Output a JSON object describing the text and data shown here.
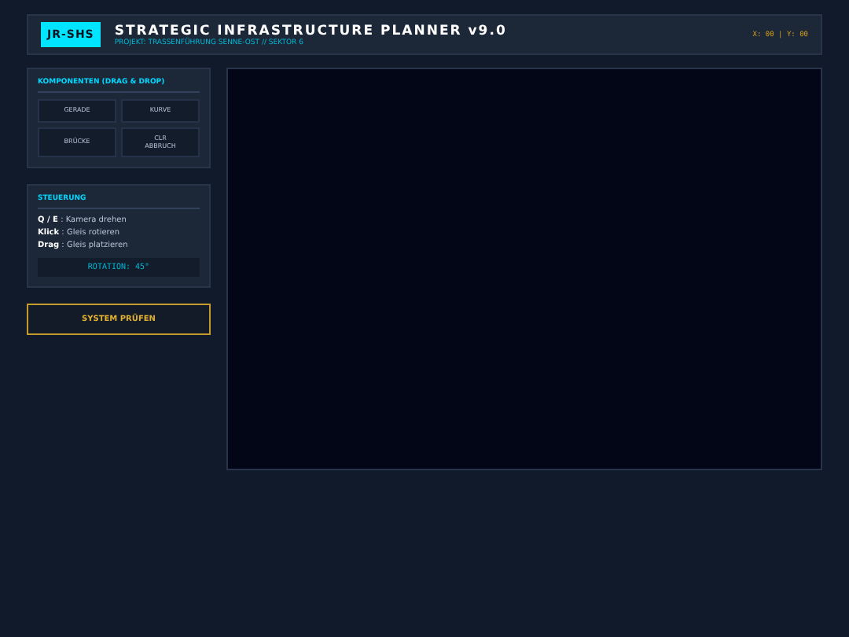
{
  "header": {
    "logo": "JR-SHS",
    "title": "STRATEGIC INFRASTRUCTURE PLANNER v9.0",
    "subtitle": "PROJEKT: TRASSENFÜHRUNG SENNE-OST // SEKTOR 6",
    "coords": "X: 00 | Y: 00"
  },
  "components": {
    "title": "KOMPONENTEN (DRAG & DROP)",
    "items": [
      "GERADE",
      "KURVE",
      "BRÜCKE",
      "CLR\nABBRUCH"
    ]
  },
  "controls": {
    "title": "STEUERUNG",
    "lines": [
      "**Q / E** : Kamera drehen",
      "**Klick** : Gleis rotieren",
      "**Drag** : Gleis platzieren"
    ],
    "rotation": "ROTATION: 45°"
  },
  "check_button": "SYSTEM PRÜFEN"
}
